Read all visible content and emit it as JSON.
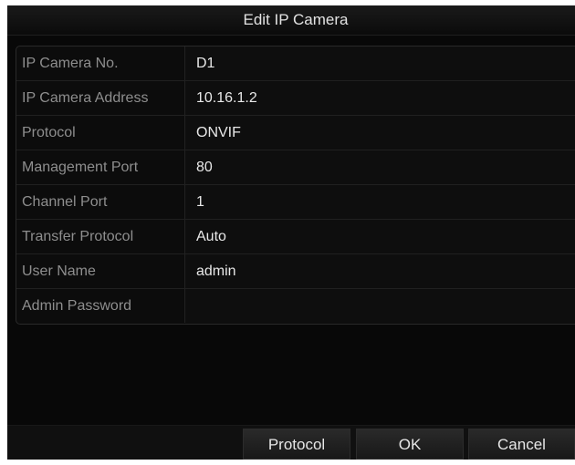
{
  "dialog": {
    "title": "Edit IP Camera"
  },
  "form": {
    "rows": [
      {
        "label": "IP Camera No.",
        "value": "D1",
        "control": "text"
      },
      {
        "label": "IP Camera Address",
        "value": "10.16.1.2",
        "control": "text"
      },
      {
        "label": "Protocol",
        "value": "ONVIF",
        "control": "dropdown"
      },
      {
        "label": "Management Port",
        "value": "80",
        "control": "text"
      },
      {
        "label": "Channel Port",
        "value": "1",
        "control": "dropdown"
      },
      {
        "label": "Transfer Protocol",
        "value": "Auto",
        "control": "dropdown"
      },
      {
        "label": "User Name",
        "value": "admin",
        "control": "text"
      },
      {
        "label": "Admin Password",
        "value": "",
        "control": "password"
      }
    ]
  },
  "footer": {
    "protocol_label": "Protocol",
    "ok_label": "OK",
    "cancel_label": "Cancel"
  },
  "icons": {
    "dropdown": "chevron-down-icon"
  },
  "colors": {
    "background": "#080808",
    "label_text": "#8e8e8e",
    "value_text": "#e8e8e8",
    "button_bg": "#222222"
  }
}
